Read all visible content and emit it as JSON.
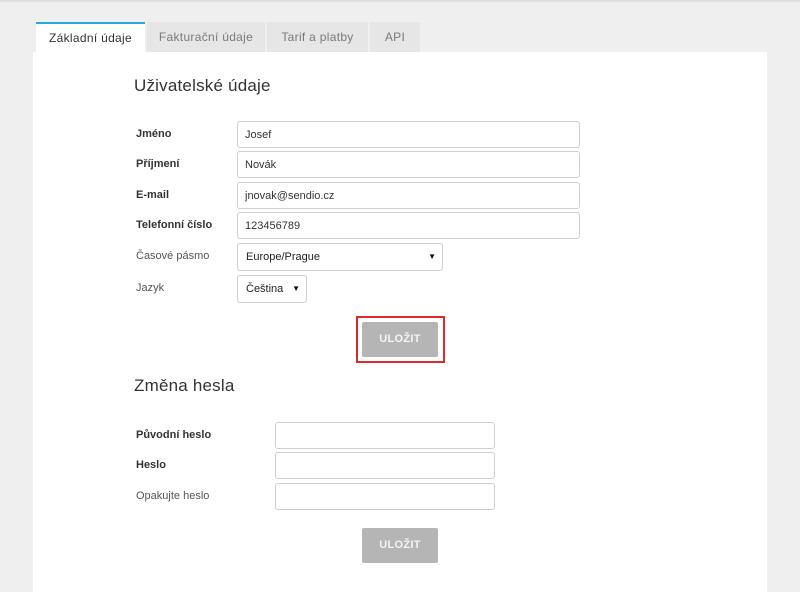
{
  "tabs": [
    {
      "label": "Základní údaje",
      "active": true
    },
    {
      "label": "Fakturační údaje",
      "active": false
    },
    {
      "label": "Tarif a platby",
      "active": false
    },
    {
      "label": "API",
      "active": false
    }
  ],
  "user_section": {
    "title": "Uživatelské údaje",
    "fields": {
      "first_name": {
        "label": "Jméno",
        "value": "Josef"
      },
      "last_name": {
        "label": "Příjmení",
        "value": "Novák"
      },
      "email": {
        "label": "E-mail",
        "value": "jnovak@sendio.cz"
      },
      "phone": {
        "label": "Telefonní číslo",
        "value": "123456789"
      },
      "timezone": {
        "label": "Časové pásmo",
        "value": "Europe/Prague"
      },
      "language": {
        "label": "Jazyk",
        "value": "Čeština"
      }
    },
    "save_label": "ULOŽIT"
  },
  "password_section": {
    "title": "Změna hesla",
    "fields": {
      "old_password": {
        "label": "Původní heslo",
        "value": ""
      },
      "new_password": {
        "label": "Heslo",
        "value": ""
      },
      "repeat_password": {
        "label": "Opakujte heslo",
        "value": ""
      }
    },
    "save_label": "ULOŽIT"
  },
  "colors": {
    "active_tab_accent": "#29a9e0",
    "highlight_border": "#e02a2a",
    "button_bg": "#b5b5b5"
  },
  "icons": {
    "select_arrow": "caret-down-icon"
  }
}
